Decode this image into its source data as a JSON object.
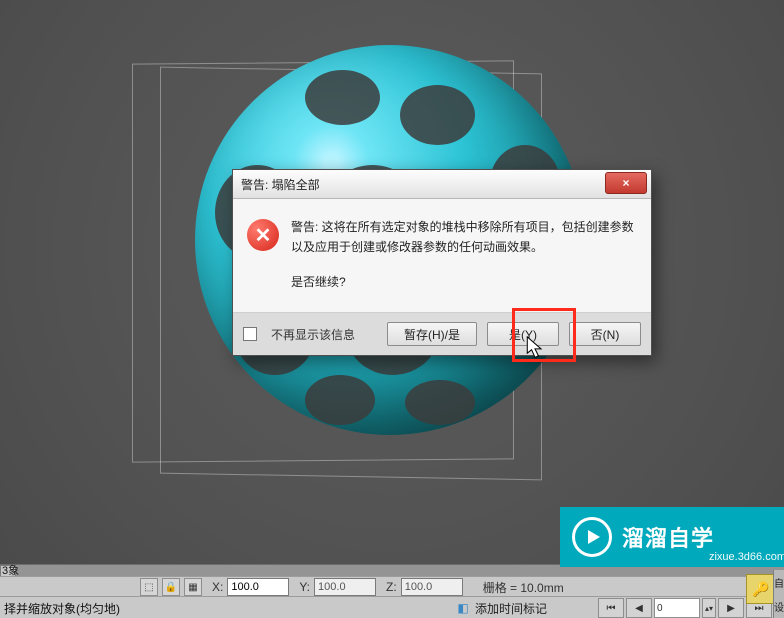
{
  "dialog": {
    "title": "警告: 塌陷全部",
    "message_line1": "警告:   这将在所有选定对象的堆栈中移除所有项目，包括创建参数以及应用于创建或修改器参数的任何动画效果。",
    "message_line2": "是否继续?",
    "checkbox_label": "不再显示该信息",
    "btn_hold_yes": "暂存(H)/是",
    "btn_yes": "是(Y)",
    "btn_no": "否(N)",
    "close": "×"
  },
  "coordbar": {
    "x_label": "X:",
    "x_value": "100.0",
    "y_label": "Y:",
    "y_value": "100.0",
    "z_label": "Z:",
    "z_value": "100.0",
    "grid_label": "栅格 = 10.0mm"
  },
  "statusbar": {
    "hint": "择并缩放对象(均匀地)",
    "add_time_tag": "添加时间标记",
    "frame_value": "0"
  },
  "timeline": {
    "prefix": "3象",
    "right1": "自",
    "right2": "设"
  },
  "brand": {
    "title": "溜溜自学",
    "url": "zixue.3d66.com"
  }
}
